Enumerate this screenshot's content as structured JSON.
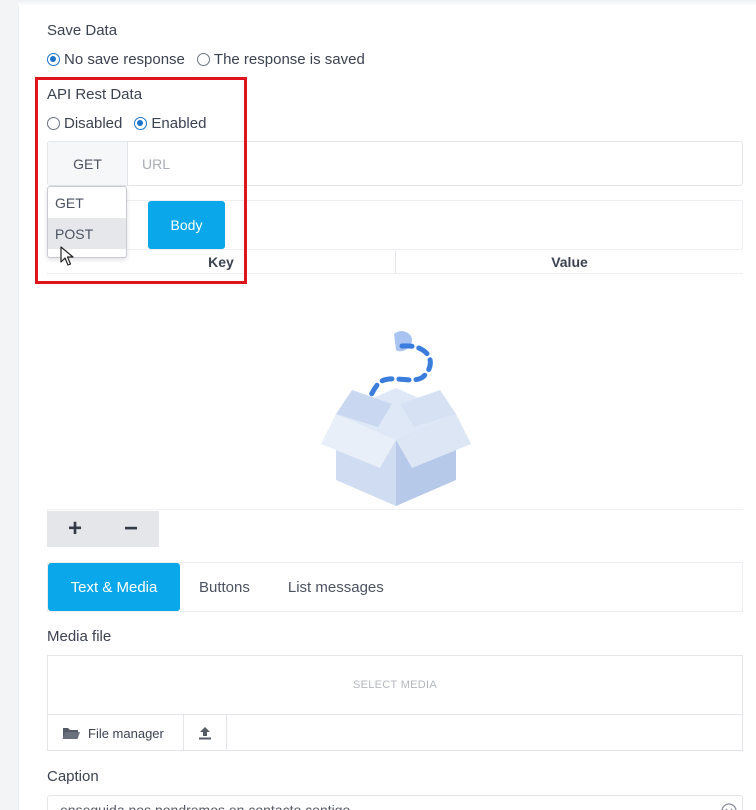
{
  "save_data": {
    "title": "Save Data",
    "options": [
      "No save response",
      "The response is saved"
    ],
    "selected": 0
  },
  "api_rest": {
    "title": "API Rest Data",
    "options": [
      "Disabled",
      "Enabled"
    ],
    "selected": 1,
    "method": "GET",
    "url_placeholder": "URL",
    "dropdown_options": [
      "GET",
      "POST"
    ],
    "dropdown_hovered": "POST",
    "body_button": "Body",
    "table_headers": [
      "Key",
      "Value"
    ],
    "add_symbol": "+",
    "remove_symbol": "−"
  },
  "message_tabs": [
    "Text & Media",
    "Buttons",
    "List messages"
  ],
  "message_tab_active": 0,
  "media": {
    "title": "Media file",
    "select_label": "SELECT MEDIA",
    "file_manager_label": "File manager"
  },
  "caption": {
    "title": "Caption",
    "value": "enseguida nos pondremos en contacto contigo"
  },
  "colors": {
    "accent": "#0aa7ea",
    "radio": "#1a73c9",
    "highlight": "#e0141b"
  },
  "icons": [
    "folder-icon",
    "upload-icon",
    "emoji-icon",
    "pointer-cursor-icon",
    "empty-box-icon"
  ]
}
